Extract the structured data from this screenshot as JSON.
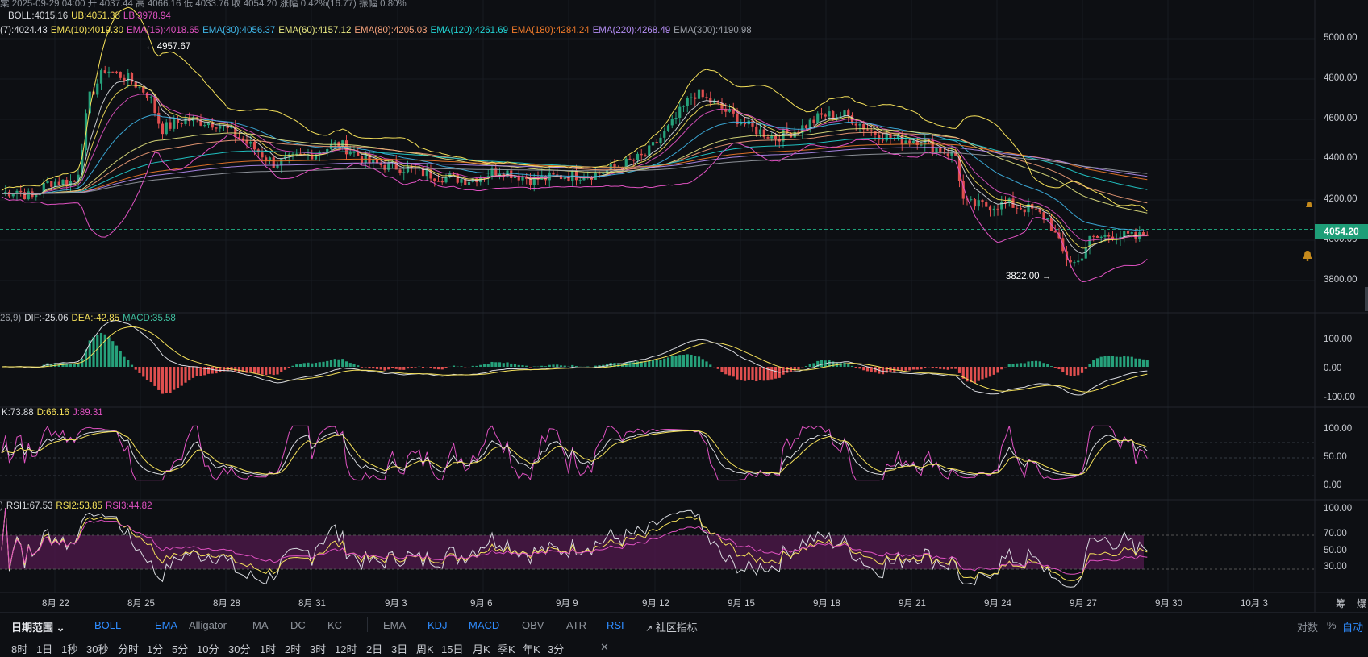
{
  "header": {
    "ohlc_line": "棠 2025-09-29 04:00 开 4037.44 高 4066.16 低 4033.76 收 4054.20 涨幅 0.42%(16.77) 振幅 0.80%"
  },
  "boll_legend": [
    {
      "text": "BOLL:4015.16",
      "color": "#d9dbe0"
    },
    {
      "text": "UB:4051.38",
      "color": "#f5e15a"
    },
    {
      "text": "LB:3978.94",
      "color": "#e052c2"
    }
  ],
  "ema_legend": [
    {
      "text": "(7):4024.43",
      "color": "#d9dbe0"
    },
    {
      "text": "EMA(10):4019.30",
      "color": "#f5e15a"
    },
    {
      "text": "EMA(15):4018.65",
      "color": "#e052c2"
    },
    {
      "text": "EMA(30):4056.37",
      "color": "#3fb6e8"
    },
    {
      "text": "EMA(60):4157.12",
      "color": "#e8e882"
    },
    {
      "text": "EMA(80):4205.03",
      "color": "#f3a07a"
    },
    {
      "text": "EMA(120):4261.69",
      "color": "#22d3d3"
    },
    {
      "text": "EMA(180):4284.24",
      "color": "#f07a2a"
    },
    {
      "text": "EMA(220):4268.49",
      "color": "#b58ef5"
    },
    {
      "text": "EMA(300):4190.98",
      "color": "#9a9ea6"
    }
  ],
  "price_axis": [
    "5000.00",
    "4800.00",
    "4600.00",
    "4400.00",
    "4200.00",
    "4000.00",
    "3800.00"
  ],
  "current_price": "4054.20",
  "annotations": {
    "high": "← 4957.67",
    "low": "3822.00 →"
  },
  "macd_legend": [
    {
      "text": "26,9)",
      "color": "#9a9ea6"
    },
    {
      "text": "DIF:-25.06",
      "color": "#d9dbe0"
    },
    {
      "text": "DEA:-42.85",
      "color": "#f5e15a"
    },
    {
      "text": "MACD:35.58",
      "color": "#3fbf9f"
    }
  ],
  "macd_axis": [
    "100.00",
    "0.00",
    "-100.00"
  ],
  "kdj_legend": [
    {
      "text": "K:73.88",
      "color": "#d9dbe0"
    },
    {
      "text": "D:66.16",
      "color": "#f5e15a"
    },
    {
      "text": "J:89.31",
      "color": "#e052c2"
    }
  ],
  "kdj_axis": [
    "100.00",
    "50.00",
    "0.00"
  ],
  "rsi_legend": [
    {
      "text": ")",
      "color": "#9a9ea6"
    },
    {
      "text": "RSI1:67.53",
      "color": "#d9dbe0"
    },
    {
      "text": "RSI2:53.85",
      "color": "#f5e15a"
    },
    {
      "text": "RSI3:44.82",
      "color": "#e052c2"
    }
  ],
  "rsi_axis": [
    "100.00",
    "70.00",
    "50.00",
    "30.00"
  ],
  "date_axis": [
    "8月 22",
    "8月 25",
    "8月 28",
    "8月 31",
    "9月 3",
    "9月 6",
    "9月 9",
    "9月 12",
    "9月 15",
    "9月 18",
    "9月 21",
    "9月 24",
    "9月 27",
    "9月 30",
    "10月 3"
  ],
  "corner_labels": [
    "筹",
    "爆"
  ],
  "toolbar": {
    "date_range": "日期范围",
    "overlay_indicators": [
      "BOLL",
      "EMA",
      "Alligator",
      "MA",
      "DC",
      "KC"
    ],
    "overlay_active": [
      "BOLL",
      "EMA"
    ],
    "sub_indicators": [
      "EMA",
      "KDJ",
      "MACD",
      "OBV",
      "ATR",
      "RSI"
    ],
    "sub_active": [
      "KDJ",
      "MACD",
      "RSI"
    ],
    "community": "社区指标",
    "right": [
      "对数",
      "%",
      "自动"
    ]
  },
  "timeframes": [
    "8时",
    "1日",
    "1秒",
    "30秒",
    "分时",
    "1分",
    "5分",
    "10分",
    "30分",
    "1时",
    "2时",
    "3时",
    "12时",
    "2日",
    "3日",
    "周K",
    "15日",
    "月K",
    "季K",
    "年K",
    "3分"
  ],
  "colors": {
    "up": "#26a17b",
    "down": "#e04f4f",
    "bg": "#0d0f13",
    "grid": "#1b1e25",
    "accent": "#2f8cff"
  }
}
